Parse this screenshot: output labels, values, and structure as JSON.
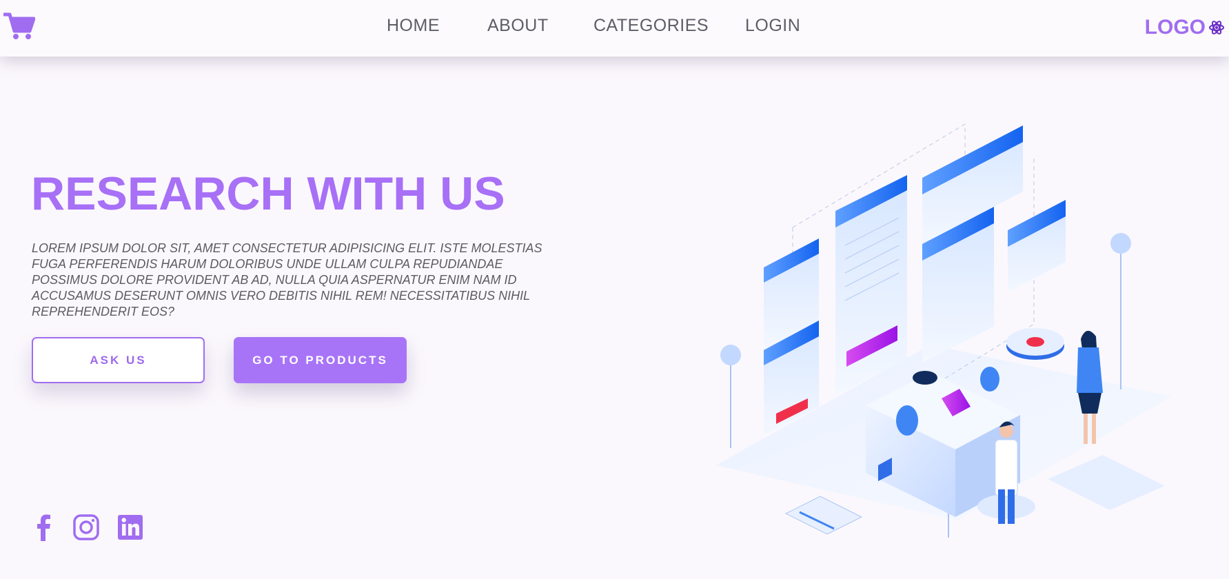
{
  "nav": {
    "cart_icon": "shopping-cart-icon",
    "links": [
      "HOME",
      "ABOUT",
      "CATEGORIES",
      "LOGIN"
    ],
    "logo_text": "LOGO",
    "logo_icon": "atom-icon"
  },
  "hero": {
    "title": "RESEARCH WITH US",
    "text": "LOREM IPSUM DOLOR SIT, AMET CONSECTETUR ADIPISICING ELIT. ISTE MOLESTIAS FUGA PERFERENDIS HARUM DOLORIBUS UNDE ULLAM CULPA REPUDIANDAE POSSIMUS DOLORE PROVIDENT AB AD, NULLA QUIA ASPERNATUR ENIM NAM ID ACCUSAMUS DESERUNT OMNIS VERO DEBITIS NIHIL REM! NECESSITATIBUS NIHIL REPREHENDERIT EOS?",
    "ask_button": "ASK US",
    "products_button": "GO TO PRODUCTS"
  },
  "social": [
    "facebook-icon",
    "instagram-icon",
    "linkedin-icon"
  ],
  "colors": {
    "accent": "#a770f6",
    "background": "#fbf8fd",
    "nav_text": "#5d5d66",
    "illustration_blue": "#2f7cf6"
  }
}
